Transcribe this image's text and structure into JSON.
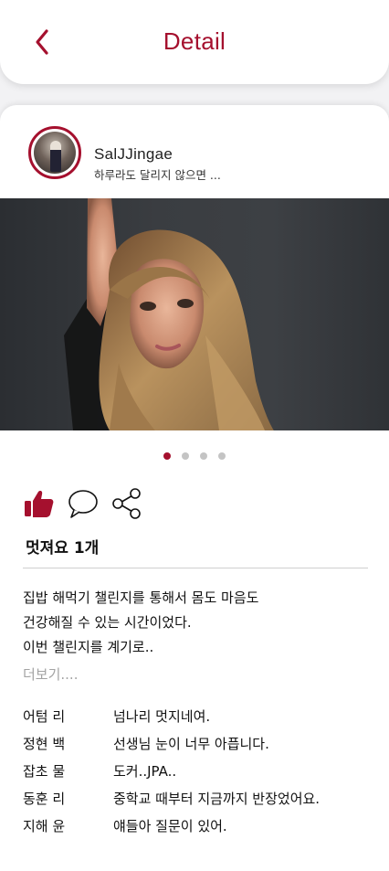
{
  "header": {
    "title": "Detail",
    "back_icon": "chevron-left-icon"
  },
  "post": {
    "username": "SalJJingae",
    "subtext": "하루라도 달리지 않으면 ...",
    "images": {
      "count": 4,
      "active_index": 0
    },
    "actions": {
      "like_icon": "thumbs-up-icon",
      "comment_icon": "speech-bubble-icon",
      "share_icon": "share-icon"
    },
    "likes_text": "멋져요 1개",
    "caption_lines": [
      "집밥 해먹기 챌린지를 통해서 몸도 마음도",
      "건강해질 수 있는 시간이었다.",
      "이번 챌린지를 계기로.."
    ],
    "more_label": "더보기....",
    "comments": [
      {
        "name": "어텀 리",
        "text": "넘나리 멋지네여."
      },
      {
        "name": "정현 백",
        "text": "선생님 눈이 너무 아픕니다."
      },
      {
        "name": "잡초 물",
        "text": "도커..JPA.."
      },
      {
        "name": "동훈 리",
        "text": "중학교 때부터 지금까지 반장었어요."
      },
      {
        "name": "지해 윤",
        "text": "얘들아 질문이 있어."
      }
    ]
  },
  "colors": {
    "accent": "#a5102e",
    "dot_inactive": "#c4c4c4",
    "more_text": "#a3a3a3"
  }
}
